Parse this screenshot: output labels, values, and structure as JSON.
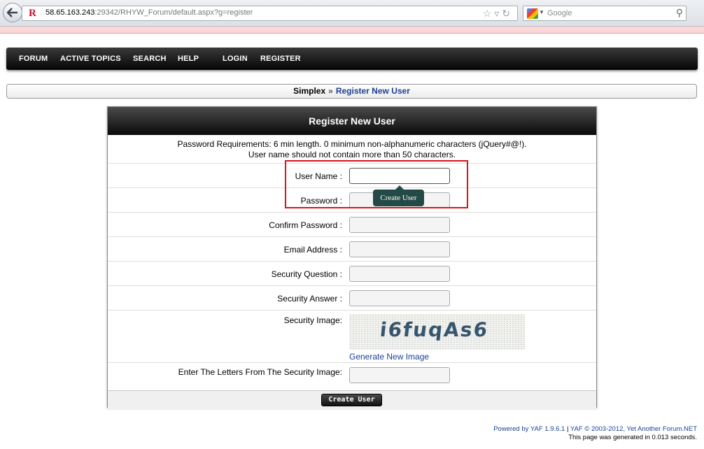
{
  "browser": {
    "url_host": "58.65.163.243",
    "url_path": ":29342/RHYW_Forum/default.aspx?g=register",
    "search_engine_placeholder": "Google"
  },
  "nav": {
    "items": [
      "FORUM",
      "ACTIVE TOPICS",
      "SEARCH",
      "HELP",
      "LOGIN",
      "REGISTER"
    ]
  },
  "breadcrumb": {
    "home": "Simplex",
    "separator": "»",
    "current": "Register New User"
  },
  "panel": {
    "title": "Register New User",
    "requirements_line1": "Password Requirements: 6 min length. 0 minimum non-alphanumeric characters (jQuery#@!).",
    "requirements_line2": "User name should not contain more than 50 characters.",
    "labels": {
      "username": "User Name :",
      "password": "Password :",
      "confirm_password": "Confirm Password :",
      "email": "Email Address :",
      "security_question": "Security Question :",
      "security_answer": "Security Answer :",
      "security_image": "Security Image:",
      "letters": "Enter The Letters From The Security Image:"
    },
    "captcha_text": "i6fuqAs6",
    "generate_link": "Generate New Image",
    "submit_label": "Create User"
  },
  "tooltip": {
    "text": "Create User"
  },
  "footer": {
    "powered_prefix": "Powered by",
    "yaf_version": "YAF 1.9.6.1",
    "separator": "|",
    "copyright": "YAF © 2003-2012, Yet Another Forum.NET",
    "generated": "This page was generated in 0.013 seconds."
  },
  "colors": {
    "highlight": "#d9141c",
    "link": "#1c3f94",
    "tooltip_bg": "#234a46",
    "nav_bg": "#0a0a0a"
  }
}
